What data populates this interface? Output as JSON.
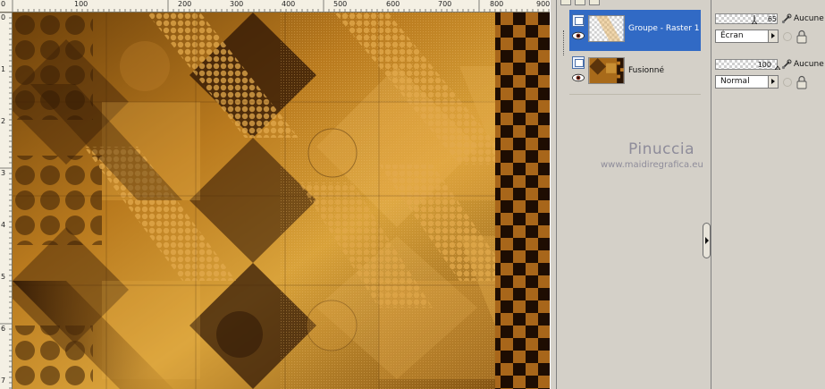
{
  "ruler_top": {
    "labels": [
      "0",
      "100",
      "200",
      "300",
      "400",
      "500",
      "600",
      "700",
      "800",
      "900"
    ]
  },
  "ruler_left": {
    "labels": [
      "0",
      "1",
      "2",
      "3",
      "4",
      "5",
      "6",
      "7"
    ]
  },
  "layers_panel": {
    "layers": [
      {
        "name": "Groupe - Raster 1",
        "selected": true,
        "icon": "raster-layer-icon"
      },
      {
        "name": "Fusionné",
        "selected": false,
        "icon": "raster-layer-icon"
      }
    ]
  },
  "properties": {
    "layer1": {
      "opacity": "65",
      "mask": "Aucune",
      "blend_mode": "Écran"
    },
    "layer2": {
      "opacity": "100",
      "mask": "Aucune",
      "blend_mode": "Normal"
    }
  },
  "watermark": {
    "title": "Pinuccia",
    "url": "www.maidiregrafica.eu"
  },
  "colors": {
    "selection": "#316ac5",
    "panel_bg": "#d4d0c8",
    "canvas_base": "#8a5a10",
    "canvas_highlight": "#d9a23a",
    "canvas_dark": "#3a1e05"
  }
}
